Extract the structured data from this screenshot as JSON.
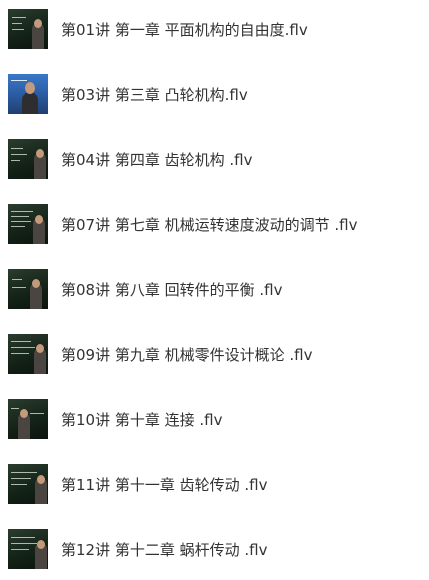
{
  "files": [
    {
      "name": "第01讲 第一章 平面机构的自由度.flv",
      "thumbnail": "lecture-video-thumbnail-icon"
    },
    {
      "name": "第03讲 第三章 凸轮机构.flv",
      "thumbnail": "lecture-video-thumbnail-icon"
    },
    {
      "name": "第04讲 第四章 齿轮机构 .flv",
      "thumbnail": "lecture-video-thumbnail-icon"
    },
    {
      "name": "第07讲 第七章 机械运转速度波动的调节 .flv",
      "thumbnail": "lecture-video-thumbnail-icon"
    },
    {
      "name": "第08讲 第八章 回转件的平衡 .flv",
      "thumbnail": "lecture-video-thumbnail-icon"
    },
    {
      "name": "第09讲 第九章 机械零件设计概论 .flv",
      "thumbnail": "lecture-video-thumbnail-icon"
    },
    {
      "name": "第10讲 第十章 连接 .flv",
      "thumbnail": "lecture-video-thumbnail-icon"
    },
    {
      "name": "第11讲 第十一章 齿轮传动 .flv",
      "thumbnail": "lecture-video-thumbnail-icon"
    },
    {
      "name": "第12讲 第十二章 蜗杆传动 .flv",
      "thumbnail": "lecture-video-thumbnail-icon"
    }
  ],
  "colors": {
    "text": "#333333",
    "background": "#ffffff",
    "thumbnail_board": "#17261b"
  }
}
